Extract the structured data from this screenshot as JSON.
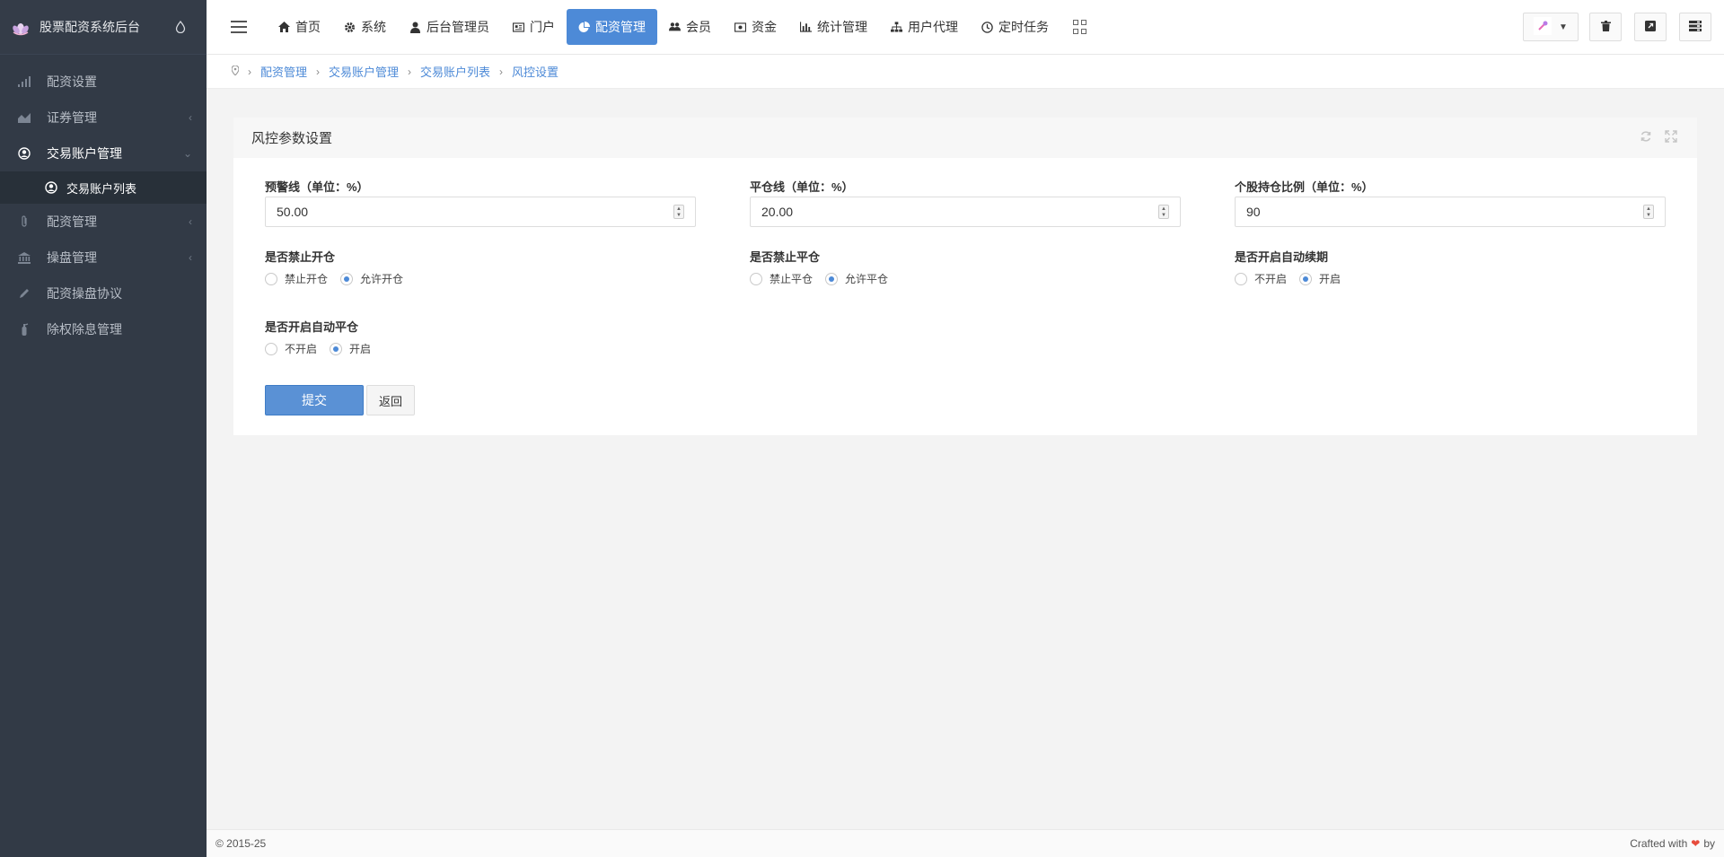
{
  "sidebar": {
    "brand_title": "股票配资系统后台",
    "items": [
      {
        "label": "配资设置",
        "icon": "signal-icon"
      },
      {
        "label": "证券管理",
        "icon": "area-chart-icon"
      },
      {
        "label": "交易账户管理",
        "icon": "user-circle-icon"
      },
      {
        "label": "配资管理",
        "icon": "paperclip-icon"
      },
      {
        "label": "操盘管理",
        "icon": "bank-icon"
      },
      {
        "label": "配资操盘协议",
        "icon": "pencil-icon"
      },
      {
        "label": "除权除息管理",
        "icon": "fire-extinguisher-icon"
      }
    ],
    "sub_item": {
      "label": "交易账户列表",
      "icon": "user-circle-icon"
    }
  },
  "topnav": {
    "items": [
      {
        "label": "首页",
        "icon": "home-icon"
      },
      {
        "label": "系统",
        "icon": "gear-icon"
      },
      {
        "label": "后台管理员",
        "icon": "user-icon"
      },
      {
        "label": "门户",
        "icon": "newspaper-icon"
      },
      {
        "label": "配资管理",
        "icon": "pie-chart-icon"
      },
      {
        "label": "会员",
        "icon": "users-icon"
      },
      {
        "label": "资金",
        "icon": "money-icon"
      },
      {
        "label": "统计管理",
        "icon": "bar-chart-icon"
      },
      {
        "label": "用户代理",
        "icon": "sitemap-icon"
      },
      {
        "label": "定时任务",
        "icon": "clock-icon"
      }
    ],
    "active": "配资管理"
  },
  "breadcrumb": [
    "配资管理",
    "交易账户管理",
    "交易账户列表",
    "风控设置"
  ],
  "panel": {
    "title": "风控参数设置",
    "fields": {
      "warning_line": {
        "label": "预警线（单位：%）",
        "value": "50.00"
      },
      "close_line": {
        "label": "平仓线（单位：%）",
        "value": "20.00"
      },
      "stock_ratio": {
        "label": "个股持仓比例（单位：%）",
        "value": "90"
      }
    },
    "radios": {
      "forbid_open": {
        "label": "是否禁止开仓",
        "options": [
          "禁止开仓",
          "允许开仓"
        ],
        "selected": 1
      },
      "forbid_close": {
        "label": "是否禁止平仓",
        "options": [
          "禁止平仓",
          "允许平仓"
        ],
        "selected": 1
      },
      "auto_renew": {
        "label": "是否开启自动续期",
        "options": [
          "不开启",
          "开启"
        ],
        "selected": 1
      },
      "auto_close": {
        "label": "是否开启自动平仓",
        "options": [
          "不开启",
          "开启"
        ],
        "selected": 1
      }
    },
    "submit_label": "提交",
    "back_label": "返回"
  },
  "footer": {
    "copyright": "© 2015-25",
    "crafted": "Crafted with",
    "by": "by"
  },
  "colors": {
    "accent": "#4d8ad7",
    "sidebar_bg": "#323a46"
  }
}
